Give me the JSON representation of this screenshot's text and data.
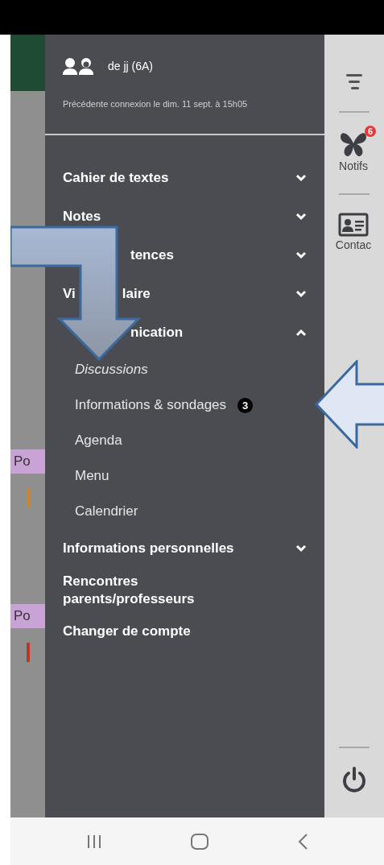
{
  "background": {
    "fragments": [
      {
        "label": "Po",
        "color": "#c9a2d6"
      },
      {
        "label": "Po",
        "color": "#c9a2d6"
      }
    ]
  },
  "drawer": {
    "user_name": "de jj (6A)",
    "last_login": "Précédente connexion le dim. 11 sept. à 15h05",
    "menu": [
      {
        "kind": "group",
        "segments": [
          {
            "text": "Cahier de textes"
          }
        ],
        "expanded": false
      },
      {
        "kind": "group",
        "segments": [
          {
            "text": "Notes"
          }
        ],
        "expanded": false
      },
      {
        "kind": "group",
        "segments": [
          {
            "covered": true
          },
          {
            "text": "tences"
          }
        ],
        "expanded": false
      },
      {
        "kind": "group",
        "segments": [
          {
            "text": "Vi"
          },
          {
            "covered": true
          },
          {
            "text": "laire"
          }
        ],
        "expanded": false
      },
      {
        "kind": "group",
        "segments": [
          {
            "covered": true
          },
          {
            "text": "nication"
          }
        ],
        "expanded": true,
        "children": [
          {
            "label": "Discussions",
            "selected": true
          },
          {
            "label": "Informations & sondages",
            "selected": false,
            "badge": "3"
          },
          {
            "label": "Agenda",
            "selected": false
          },
          {
            "label": "Menu",
            "selected": false
          },
          {
            "label": "Calendrier",
            "selected": false
          }
        ]
      },
      {
        "kind": "group",
        "segments": [
          {
            "text": "Informations personnelles"
          }
        ],
        "expanded": false
      },
      {
        "kind": "link",
        "label": "Rencontres parents/professeurs"
      },
      {
        "kind": "link",
        "label": "Changer de compte"
      }
    ]
  },
  "rail": {
    "items": [
      {
        "kind": "menu"
      },
      {
        "kind": "notifs",
        "label": "Notifs",
        "badge": "6"
      },
      {
        "kind": "contact",
        "label": "Contac"
      },
      {
        "kind": "power"
      }
    ]
  }
}
